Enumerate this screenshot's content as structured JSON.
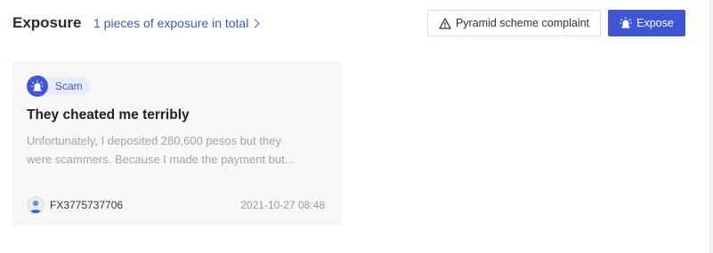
{
  "header": {
    "title": "Exposure",
    "summary_link": "1 pieces of exposure in total",
    "complaint_button": "Pyramid scheme complaint",
    "expose_button": "Expose"
  },
  "cards": [
    {
      "tag": "Scam",
      "title": "They cheated me terribly",
      "desc_line1": "Unfortunately, I deposited 280,600 pesos but they",
      "desc_line2": "were scammers. Because I made the payment but...",
      "username": "FX3775737706",
      "date": "2021-10-27 08:48"
    }
  ],
  "colors": {
    "accent": "#3f57d6",
    "link": "#3a5bbf",
    "card_bg": "#f7f7f8"
  },
  "icons": {
    "complaint": "warning-triangle-icon",
    "expose": "alarm-siren-icon",
    "tag": "alarm-siren-icon",
    "link_arrow": "chevron-right-icon",
    "avatar": "user-avatar-icon"
  }
}
